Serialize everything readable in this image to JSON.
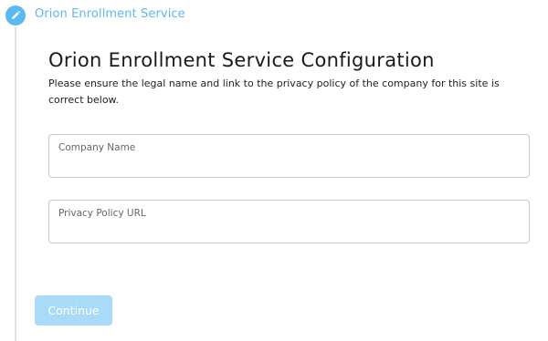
{
  "stepper": {
    "step_title": "Orion Enrollment Service",
    "step_icon": "pencil-icon",
    "accent_color": "#5bb8f0"
  },
  "main": {
    "title": "Orion Enrollment Service Configuration",
    "description": "Please ensure the legal name and link to the privacy policy of the company for this site is correct below."
  },
  "form": {
    "company_name_placeholder": "Company Name",
    "company_name_value": "",
    "privacy_url_placeholder": "Privacy Policy URL",
    "privacy_url_value": ""
  },
  "actions": {
    "continue_label": "Continue",
    "continue_disabled": true,
    "continue_color": "#a9daf8"
  }
}
